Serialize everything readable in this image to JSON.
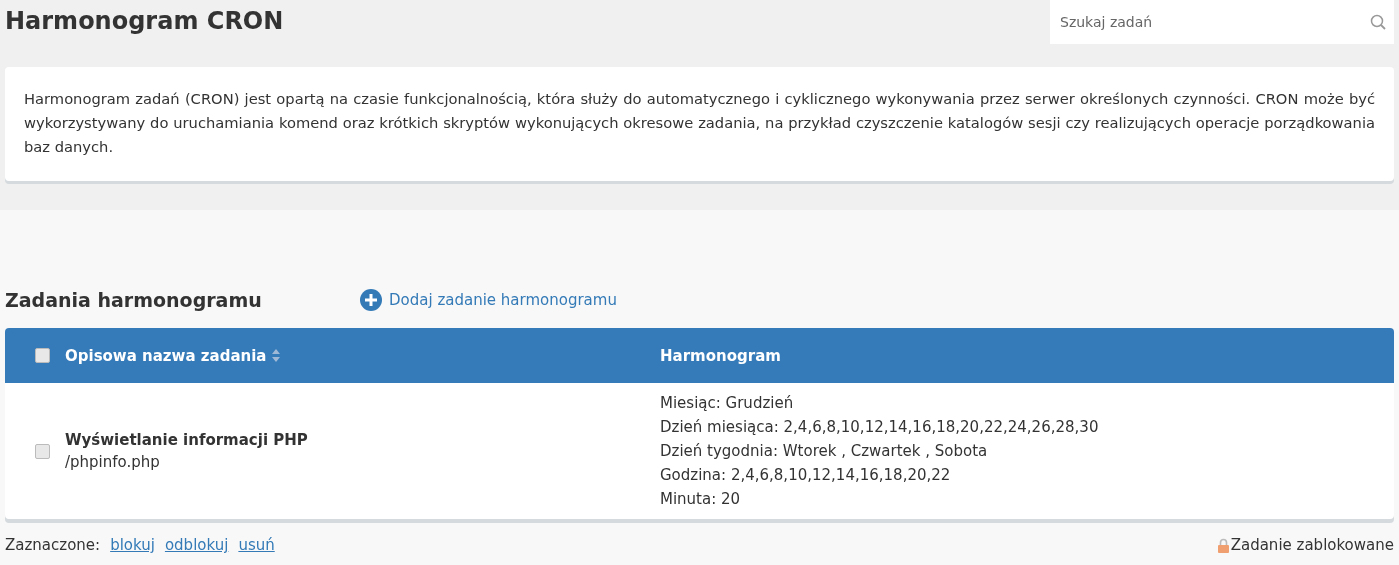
{
  "page_title": "Harmonogram CRON",
  "search": {
    "placeholder": "Szukaj zadań"
  },
  "intro": "Harmonogram zadań (CRON) jest opartą na czasie funkcjonalnością, która służy do automatycznego i cyklicznego wykonywania przez serwer określonych czynności. CRON może być wykorzystywany do uruchamiania komend oraz krótkich skryptów wykonujących okresowe zadania, na przykład czyszczenie katalogów sesji czy realizujących operacje porządkowania baz danych.",
  "section_title": "Zadania harmonogramu",
  "add_link": "Dodaj zadanie harmonogramu",
  "table": {
    "select_all_checked": false,
    "columns": [
      {
        "label": "Opisowa nazwa zadania",
        "sortable": true
      },
      {
        "label": "Harmonogram",
        "sortable": false
      }
    ],
    "rows": [
      {
        "checked": false,
        "name": "Wyświetlanie informacji PHP",
        "path": "/phpinfo.php",
        "schedule": [
          "Miesiąc: Grudzień",
          "Dzień miesiąca: 2,4,6,8,10,12,14,16,18,20,22,24,26,28,30",
          "Dzień tygodnia: Wtorek , Czwartek , Sobota",
          "Godzina: 2,4,6,8,10,12,14,16,18,20,22",
          "Minuta: 20"
        ]
      }
    ]
  },
  "footer": {
    "label": "Zaznaczone:",
    "actions": [
      "blokuj",
      "odblokuj",
      "usuń"
    ],
    "legend": "Zadanie zablokowane"
  }
}
